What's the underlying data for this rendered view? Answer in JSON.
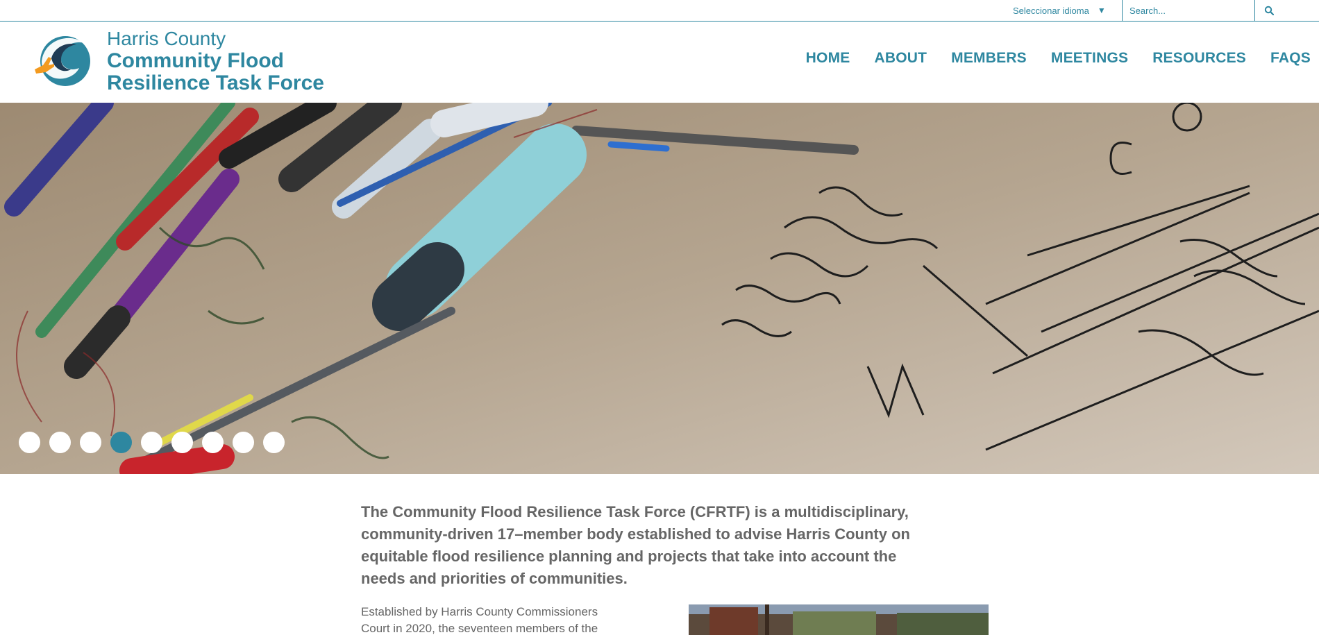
{
  "topbar": {
    "language_label": "Seleccionar idioma",
    "language_arrow": "▼",
    "search_placeholder": "Search...",
    "search_icon": "search-icon"
  },
  "header": {
    "title_line1": "Harris County",
    "title_line2": "Community Flood",
    "title_line3": "Resilience Task Force",
    "logo_icon": "wave-hand-logo-icon"
  },
  "nav": {
    "items": [
      {
        "label": "HOME"
      },
      {
        "label": "ABOUT"
      },
      {
        "label": "MEMBERS"
      },
      {
        "label": "MEETINGS"
      },
      {
        "label": "RESOURCES"
      },
      {
        "label": "FAQS"
      }
    ]
  },
  "hero": {
    "slide_count": 9,
    "active_slide": 4,
    "image": "planning-table-with-markers-photo"
  },
  "content": {
    "lead": "The Community Flood Resilience Task Force (CFRTF) is a multidisciplinary, community-driven 17–member body established to advise Harris County on equitable flood resilience planning and projects that take into account the needs and priorities of communities.",
    "body": "Established by Harris County Commissioners Court in 2020, the seventeen members of the"
  },
  "colors": {
    "accent": "#2e87a0",
    "text": "#666666",
    "slide_dot": "#ffffff",
    "slide_dot_active": "#2e87a0"
  }
}
